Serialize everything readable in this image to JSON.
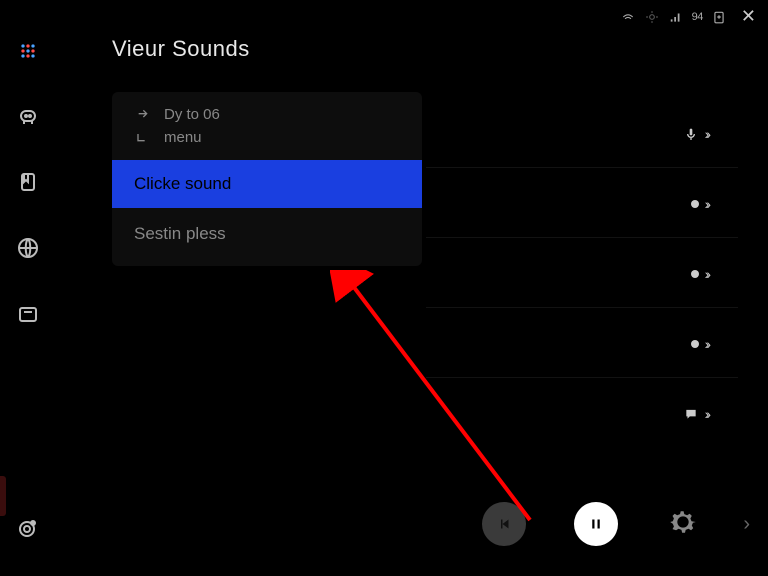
{
  "status_bar": {
    "network_label": "94"
  },
  "panel": {
    "title": "Vieur Sounds",
    "dy_line": "Dy to 06",
    "menu_line": "menu",
    "selected": "Clicke sound",
    "secondary": "Sestin pless"
  },
  "sidebar": {
    "items": [
      "apps",
      "robot",
      "bookmark",
      "globe",
      "folder",
      "camera"
    ]
  },
  "right_rows": [
    {
      "icon": "mic"
    },
    {
      "icon": "dot"
    },
    {
      "icon": "dot"
    },
    {
      "icon": "dot"
    },
    {
      "icon": "chat"
    }
  ],
  "footer": {
    "buttons": [
      "prev",
      "pause",
      "settings",
      "next"
    ]
  },
  "colors": {
    "selected_bg": "#1a3fe0",
    "arrow": "#ff0000"
  }
}
